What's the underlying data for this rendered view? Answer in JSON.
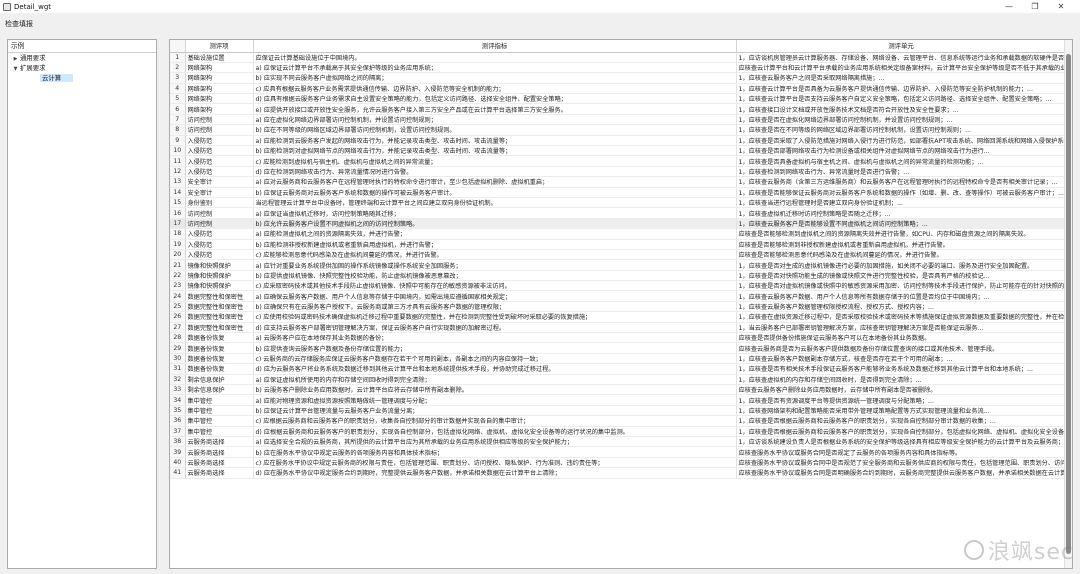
{
  "window": {
    "title": "Detail_wgt",
    "minimize": "—",
    "maximize": "❐",
    "close": "✕"
  },
  "menu": {
    "item1": "检查填报"
  },
  "tree": {
    "header": "示例",
    "nodes": [
      {
        "label": "通用要求",
        "arrow": "▶",
        "level": 0
      },
      {
        "label": "扩展要求",
        "arrow": "▼",
        "level": 0
      },
      {
        "label": "云计算",
        "arrow": "",
        "level": 1,
        "selected": true
      }
    ]
  },
  "table": {
    "columns": [
      "",
      "测评项",
      "测评指标",
      "测评单元"
    ],
    "rows": [
      [
        "1",
        "基础设施位置",
        "应保证云计算基础设施位于中国境内。",
        "1，应访谈机房管理员云计算服务器、存储设备、网络设备、云管理平台、信息系统等运行业务和承载数据的软硬件是否均位于中国境内"
      ],
      [
        "2",
        "网络架构",
        "a) 应保证云计算平台不承载高于其安全保护等级的业务应用系统；",
        "应核查云计算平台和云计算平台承载的业务应用系统相关定级备案材料，云计算平台安全保护等级是否不低于其承载的业务应用系统安全保护等级"
      ],
      [
        "3",
        "网络架构",
        "b) 应实现不同云服务客户虚拟网络之间的隔离；",
        "1，应核查云服务客户之间是否采取网络隔离措施；..."
      ],
      [
        "4",
        "网络架构",
        "c) 应具有根据云服务客户业务需求提供通信传输、边界防护、入侵防范等安全机制的能力；",
        "1，应核查云计算平台是否具备为云服务客户提供通信传输、边界防护、入侵防范等安全防护机制的能力；..."
      ],
      [
        "5",
        "网络架构",
        "d) 应具有根据云服务客户业务需求自主设置安全策略的能力，包括定义访问路径、选择安全组件、配置安全策略；",
        "1，应核查云计算平台是否支持云服务客户自定义安全策略，包括定义访问路径、选择安全组件、配置安全策略；..."
      ],
      [
        "6",
        "网络架构",
        "e) 应提供开放接口或开放性安全服务，允许云服务客户接入第三方安全产品或在云计算平台选择第三方安全服务。",
        "1，应核查接口设计文档或开放性服务技术文档是否符合开放性及安全性要求；..."
      ],
      [
        "7",
        "访问控制",
        "a) 应在虚拟化网络边界部署访问控制机制，并设置访问控制规则；",
        "1，应核查是否在虚拟化网络边界部署访问控制机制，并设置访问控制规则；..."
      ],
      [
        "8",
        "访问控制",
        "b) 应在不同等级的网络区域边界部署访问控制机制，设置访问控制规则。",
        "1，应核查是否在不同等级的网络区域边界部署访问控制机制，设置访问控制规则；..."
      ],
      [
        "9",
        "入侵防范",
        "a) 应能检测到云服务客户发起的网络攻击行为，并能记录攻击类型、攻击时间、攻击流量等；",
        "1，应核查是否采取了入侵防范措施对网络入侵行为进行防范，如部署抗APT攻击系统、网络回溯系统和网络入侵保护系统等入侵防范设备"
      ],
      [
        "10",
        "入侵防范",
        "b) 应能检测到对虚拟网络节点的网络攻击行为，并能记录攻击类型、攻击时间、攻击流量等；",
        "1，应核查是否部署网络攻击行为检测设备或相关组件对虚拟网络节点的网络攻击行为进行..."
      ],
      [
        "11",
        "入侵防范",
        "c) 应能检测到虚拟机与宿主机、虚拟机与虚拟机之间的异常流量；",
        "1，应核查是否具备虚拟机与宿主机之间、虚拟机与虚拟机之间的异常流量的检测功能；..."
      ],
      [
        "12",
        "入侵防范",
        "d) 应在检测到网络攻击行为、异常流量情况时进行告警。",
        "1，应核查检测到网络攻击行为、异常流量时是否进行告警；..."
      ],
      [
        "13",
        "安全审计",
        "a) 应对云服务商和云服务客户在远程管理时执行的特权命令进行审计，至少包括虚拟机删除、虚拟机重启；",
        "1，应核查云服务商（含第三方运维服务商）和云服务客户在远程管理时执行的远程特权命令是否有相关审计记录；..."
      ],
      [
        "14",
        "安全审计",
        "b) 应保证云服务商对云服务客户系统和数据的操作可被云服务客户审计。",
        "1，应核查是否能够保证云服务商对云服务客户系统和数据的操作（如增、删、改、查等操作）可被云服务客户审计；..."
      ],
      [
        "15",
        "身份鉴别",
        "当远程管理云计算平台中设备时，管理终端和云计算平台之间应建立双向身份验证机制。",
        "1，应核查当进行远程管理时是否建立双向身份验证机制；..."
      ],
      [
        "16",
        "访问控制",
        "a) 应保证当虚拟机迁移时，访问控制策略随其迁移；",
        "1，应核查虚拟机迁移时访问控制策略是否随之迁移；..."
      ],
      [
        "17",
        "访问控制",
        "b) 应允许云服务客户设置不同虚拟机之间的访问控制策略。",
        "1，应核查云服务客户是否能够设置不同虚拟机之间访问控制策略；..."
      ],
      [
        "18",
        "入侵防范",
        "a) 应能检测虚拟机之间的资源隔离失效，并进行告警；",
        "应核查是否能够检测到虚拟机之间的资源隔离失效并进行告警，如CPU、内存和磁盘资源之间的隔离失效。"
      ],
      [
        "19",
        "入侵防范",
        "b) 应能检测非授权新建虚拟机或者重新启用虚拟机，并进行告警；",
        "应核查是否能够检测到非授权新建虚拟机或者重新启用虚拟机，并进行告警。"
      ],
      [
        "20",
        "入侵防范",
        "c) 应能够检测恶意代码感染及在虚拟机间蔓延的情况，并进行告警。",
        "应核查是否能够检测恶意代码感染及在虚拟机间蔓延的情况，并进行告警。"
      ],
      [
        "21",
        "镜像和快照保护",
        "a) 应针对重要业务系统提供加固的操作系统镜像或操作系统安全加固服务；",
        "1，应核查是否对生成的虚拟机镜像进行必要的加固措施，如关闭不必要的端口、服务及进行安全加固配置。"
      ],
      [
        "22",
        "镜像和快照保护",
        "b) 应提供虚拟机镜像、快照完整性校验功能，防止虚拟机镜像被恶意篡改；",
        "1，应核查是否对快照功能生成的镜像或快照文件进行完整性校验，是否具有严格的校验记..."
      ],
      [
        "23",
        "镜像和快照保护",
        "c) 应采取密码技术或其他技术手段防止虚拟机镜像、快照中可能存在的敏感资源被非法访问。",
        "1，应核查是否对虚拟机镜像或快照中的敏感资源采用加密、访问控制等技术手段进行保护，防止可能存在的针对快照的非法访问。"
      ],
      [
        "24",
        "数据完整性和保密性",
        "a) 应确保云服务客户数据、用户个人信息等存储于中国境内，如需出境应遵循国家相关规定；",
        "1，应核查云服务客户数据、用户个人信息等所有数据存储于的位置是否均位于中国境内；..."
      ],
      [
        "25",
        "数据完整性和保密性",
        "b) 应确保只有在云服务客户授权下，云服务商或第三方才具有云服务客户数据的管理权限；",
        "1，应核查云服务客户数据管理权限授权流程、授权方式、授权内容；..."
      ],
      [
        "26",
        "数据完整性和保密性",
        "c) 应使用校验码或密码技术确保虚拟机迁移过程中重要数据的完整性，并在检测到完整性受到破坏时采取必要的恢复措施；",
        "1，应核查在虚拟资源迁移过程中，是否采取校验技术或密码技术等措施保证虚拟资源数据及重要数据的完整性，并在检测到完整性受到破坏时是否采取必要的恢复措施"
      ],
      [
        "27",
        "数据完整性和保密性",
        "d) 应支持云服务客户部署密钥管理解决方案，保证云服务客户自行实现数据的加解密过程。",
        "1，当云服务客户已部署密钥管理解决方案，应核查密钥管理解决方案是否能保证云服务..."
      ],
      [
        "28",
        "数据备份恢复",
        "a) 云服务客户应在本地保存其业务数据的备份；",
        "应核查是否提供备份措施保证云服务客户可以在本地备份其业务数据。"
      ],
      [
        "29",
        "数据备份恢复",
        "b) 应提供查询云服务客户数据及备份存储位置的能力；",
        "应核查云服务商是否为云服务客户提供数据及备份存储位置查询的接口或其他技术、管理手段。"
      ],
      [
        "30",
        "数据备份恢复",
        "c) 云服务商的云存储服务应保证云服务客户数据存在若干个可用的副本，各副本之间的内容应保持一致；",
        "1，应核查云服务客户数据副本存储方式，核查是否存在若干个可用的副本；..."
      ],
      [
        "31",
        "数据备份恢复",
        "d) 应为云服务客户将业务系统及数据迁移到其他云计算平台和本地系统提供技术手段，并协助完成迁移过程。",
        "1，应核查是否有相关技术手段保证云服务客户能够将业务系统及数据迁移到其他云计算平台和本地系统；..."
      ],
      [
        "32",
        "剩余信息保护",
        "a) 应保证虚拟机所使用的内存和存储空间回收时得到完全清除；",
        "1，应核查虚拟机的内存和存储空间回收时，是否得到完全清除；..."
      ],
      [
        "33",
        "剩余信息保护",
        "b) 云服务客户删除业务应用数据时，云计算平台应将云存储中所有副本删除。",
        "应核查云服务客户删除业务应用数据时，云存储中所有副本是否被删除。"
      ],
      [
        "34",
        "集中管控",
        "a) 应能对物理资源和虚拟资源按照策略做统一管理调度与分配；",
        "1，应核查是否有资源调度平台等提供资源统一管理调度与分配策略；..."
      ],
      [
        "35",
        "集中管控",
        "b) 应保证云计算平台管理流量与云服务客户业务流量分离；",
        "1，应核查网络架构和配置策略能否采用带外管理或策略配置等方式实现管理流量和业务流..."
      ],
      [
        "36",
        "集中管控",
        "c) 应根据云服务商和云服务客户的职责划分，收集各自控制部分的审计数据并实现各自的集中审计；",
        "1，应核查是否根据云服务商和云服务客户的职责划分，实现各自控制部分审计数据的收集；..."
      ],
      [
        "37",
        "集中管控",
        "d) 应根据云服务商和云服务客户的职责划分，实现各自控制部分，包括虚拟化网络、虚拟机、虚拟化安全设备等的运行状况的集中监测。",
        "1，应核查是否根据云服务商和云服务客户的职责划分，实现各自控制部分，包括虚拟化网络、虚拟机、虚拟化安全设备等的运行状况的集中监测"
      ],
      [
        "38",
        "云服务商选择",
        "a) 应选择安全合规的云服务商，其所提供的云计算平台应为其所承载的业务应用系统提供相应等级的安全保护能力；",
        "1，应访谈系统建设负责人是否根据业务系统的安全保护等级选择具有相应等级安全保护能力的云计算平台及云服务商；..."
      ],
      [
        "39",
        "云服务商选择",
        "b) 应在服务水平协议中规定云服务的各项服务内容和具体技术指标；",
        "应核查服务水平协议或服务合同是否规定了云服务的各项服务内容和具体指标等。"
      ],
      [
        "40",
        "云服务商选择",
        "c) 应在服务水平协议中规定云服务商的权限与责任，包括管理范围、职责划分、访问授权、隐私保护、行为准则、违约责任等；",
        "应核查服务水平协议或服务合同中是否规范了安全服务商和云服务供应商的权限与责任，包括管理范围、职责划分、访问授权、隐私保护"
      ],
      [
        "41",
        "云服务商选择",
        "d) 应在服务水平协议中规定服务合约到期时，完整提供云服务客户数据，并承诺相关数据在云计算平台上清除；",
        "应核查服务水平协议或服务合同是否明确服务合约到期时，云服务商完整提供云服务客户数据，并承诺相关数据在云计算平台上清除"
      ]
    ],
    "highlight_row": 17
  },
  "watermark": {
    "text": "浪飒sec"
  }
}
